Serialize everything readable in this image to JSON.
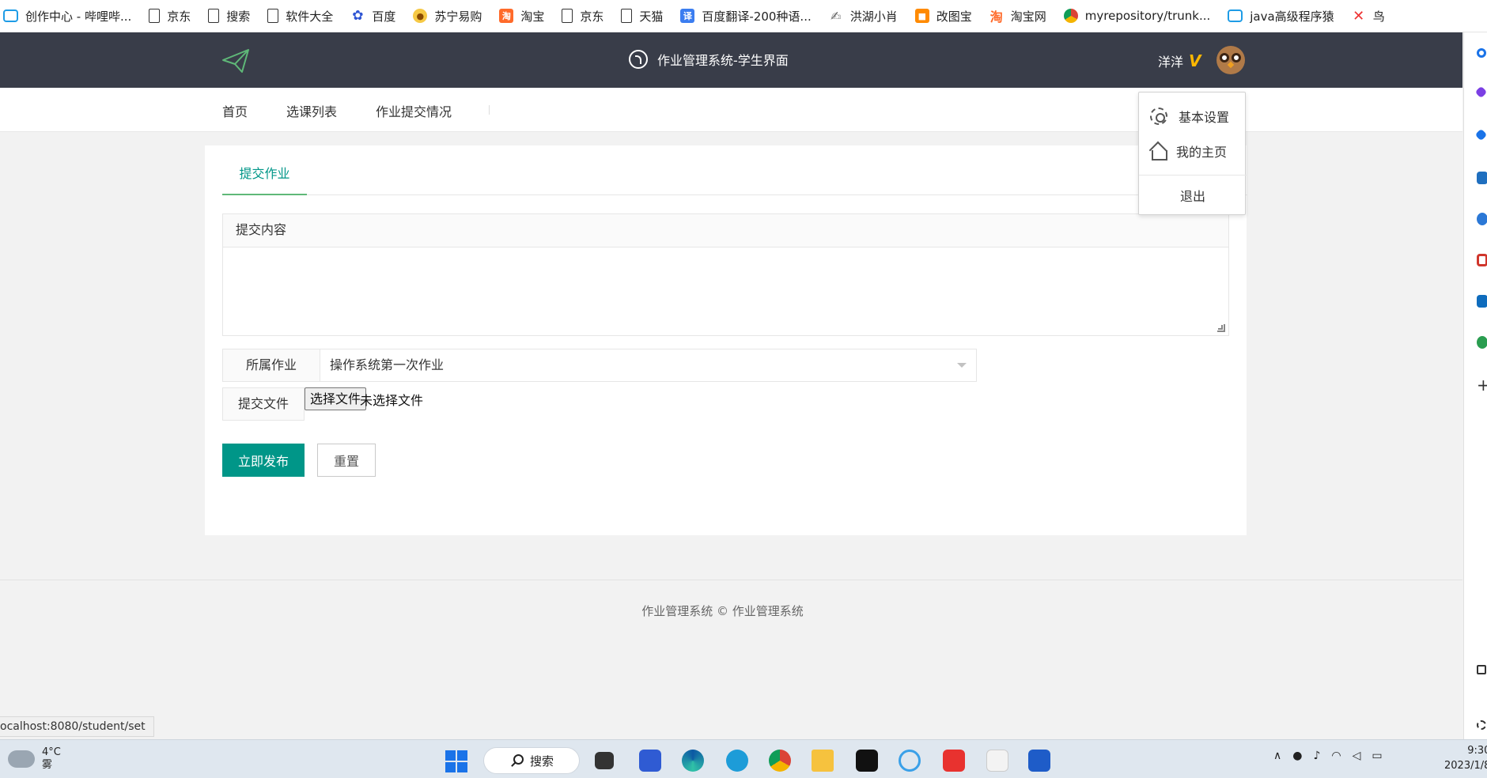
{
  "bookmarks": [
    {
      "label": "创作中心 - 哔哩哔...",
      "icon": "bilibili-icon"
    },
    {
      "label": "京东",
      "icon": "page-icon"
    },
    {
      "label": "搜索",
      "icon": "page-icon"
    },
    {
      "label": "软件大全",
      "icon": "page-icon"
    },
    {
      "label": "百度",
      "icon": "baidu-icon"
    },
    {
      "label": "苏宁易购",
      "icon": "suning-icon"
    },
    {
      "label": "淘宝",
      "icon": "taobao-icon"
    },
    {
      "label": "京东",
      "icon": "page-icon"
    },
    {
      "label": "天猫",
      "icon": "page-icon"
    },
    {
      "label": "百度翻译-200种语...",
      "icon": "translate-icon"
    },
    {
      "label": "洪湖小肖",
      "icon": "hong-icon"
    },
    {
      "label": "改图宝",
      "icon": "gaitubao-icon"
    },
    {
      "label": "淘宝网",
      "icon": "taobao-icon"
    },
    {
      "label": "myrepository/trunk...",
      "icon": "chrome-icon"
    },
    {
      "label": "java高级程序猿",
      "icon": "bilibili-icon"
    },
    {
      "label": "鸟",
      "icon": "bird-icon"
    }
  ],
  "header": {
    "system_title": "作业管理系统-学生界面",
    "username": "洋洋",
    "vip_badge": "V"
  },
  "nav": {
    "items": [
      "首页",
      "选课列表",
      "作业提交情况"
    ]
  },
  "user_menu": {
    "items": [
      "基本设置",
      "我的主页",
      "退出"
    ]
  },
  "form": {
    "tab": "提交作业",
    "content_label": "提交内容",
    "content_value": "",
    "homework_label": "所属作业",
    "homework_selected": "操作系统第一次作业",
    "file_label": "提交文件",
    "file_button": "选择文件",
    "file_status": "未选择文件",
    "submit_button": "立即发布",
    "reset_button": "重置"
  },
  "footer": {
    "text": "作业管理系统 ©  作业管理系统"
  },
  "status_url": "ocalhost:8080/student/set",
  "taskbar": {
    "temperature": "4°C",
    "weather": "雾",
    "search_label": "搜索",
    "time": "9:30",
    "date": "2023/1/8"
  },
  "colors": {
    "header_bg": "#393d49",
    "primary": "#009688",
    "tab_underline": "#5fb878",
    "vip": "#ffb800"
  }
}
